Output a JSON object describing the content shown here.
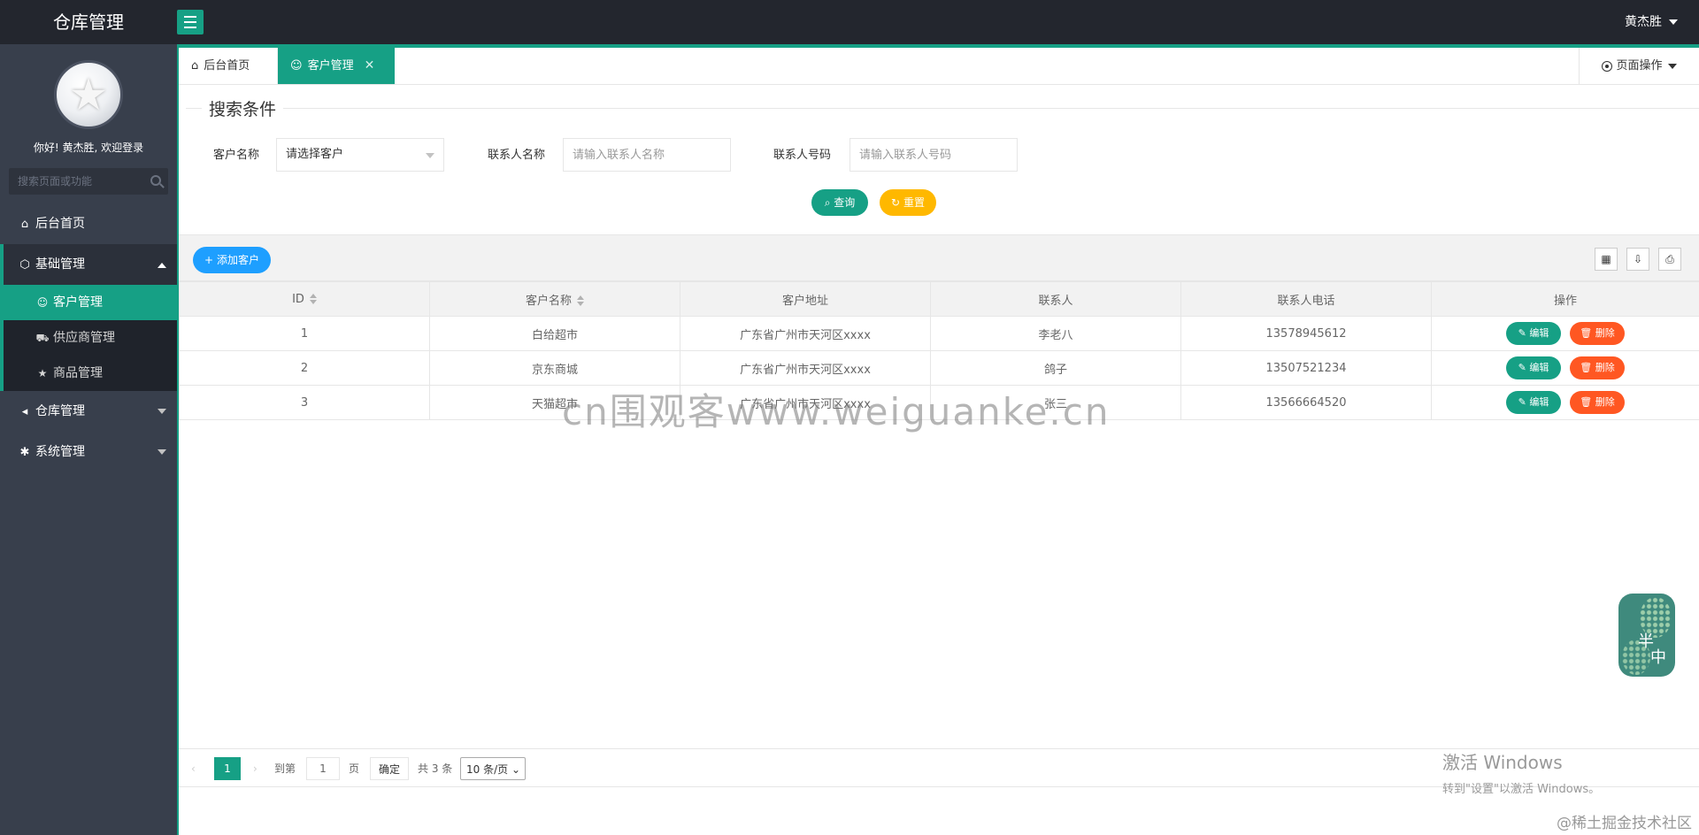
{
  "app": {
    "title": "仓库管理",
    "user_name": "黄杰胜"
  },
  "sidebar": {
    "welcome": "你好! 黄杰胜, 欢迎登录",
    "search_placeholder": "搜索页面或功能",
    "items": [
      {
        "label": "后台首页",
        "icon": "home-icon"
      },
      {
        "label": "基础管理",
        "icon": "cube-icon",
        "expanded": true,
        "children": [
          {
            "label": "客户管理",
            "icon": "user-icon",
            "active": true
          },
          {
            "label": "供应商管理",
            "icon": "cart-icon"
          },
          {
            "label": "商品管理",
            "icon": "star-icon"
          }
        ]
      },
      {
        "label": "仓库管理",
        "icon": "speaker-icon"
      },
      {
        "label": "系统管理",
        "icon": "gear-icon"
      }
    ]
  },
  "tabs": [
    {
      "label": "后台首页",
      "icon": "home-icon"
    },
    {
      "label": "客户管理",
      "icon": "user-icon",
      "active": true
    }
  ],
  "page_ops_label": "页面操作",
  "search": {
    "legend": "搜索条件",
    "customer_label": "客户名称",
    "customer_value": "请选择客户",
    "contact_label": "联系人名称",
    "contact_placeholder": "请输入联系人名称",
    "phone_label": "联系人号码",
    "phone_placeholder": "请输入联系人号码",
    "query_button": "查询",
    "reset_button": "重置"
  },
  "table": {
    "add_button": "添加客户",
    "columns": [
      "ID",
      "客户名称",
      "客户地址",
      "联系人",
      "联系人电话",
      "操作"
    ],
    "rows": [
      {
        "id": "1",
        "name": "白给超市",
        "address": "广东省广州市天河区xxxx",
        "contact": "李老八",
        "phone": "13578945612"
      },
      {
        "id": "2",
        "name": "京东商城",
        "address": "广东省广州市天河区xxxx",
        "contact": "鸽子",
        "phone": "13507521234"
      },
      {
        "id": "3",
        "name": "天猫超市",
        "address": "广东省广州市天河区xxxx",
        "contact": "张三",
        "phone": "13566664520"
      }
    ],
    "edit_label": "编辑",
    "delete_label": "删除"
  },
  "pager": {
    "current_page": "1",
    "goto_label": "到第",
    "goto_value": "1",
    "page_unit": "页",
    "confirm": "确定",
    "total": "共 3 条",
    "page_size": "10 条/页"
  },
  "widget": {
    "char1": "半",
    "char2": "中"
  },
  "watermarks": {
    "center": "cn围观客www.weiguanke.cn",
    "win_line1": "激活 Windows",
    "win_line2": "转到\"设置\"以激活 Windows。",
    "credit": "@稀土掘金技术社区"
  },
  "colors": {
    "accent": "#16a085",
    "topbar": "#23262e",
    "sidebar": "#383f4c",
    "primary_blue": "#1e9fff",
    "warn_orange": "#ffb800",
    "danger": "#ff5722"
  }
}
